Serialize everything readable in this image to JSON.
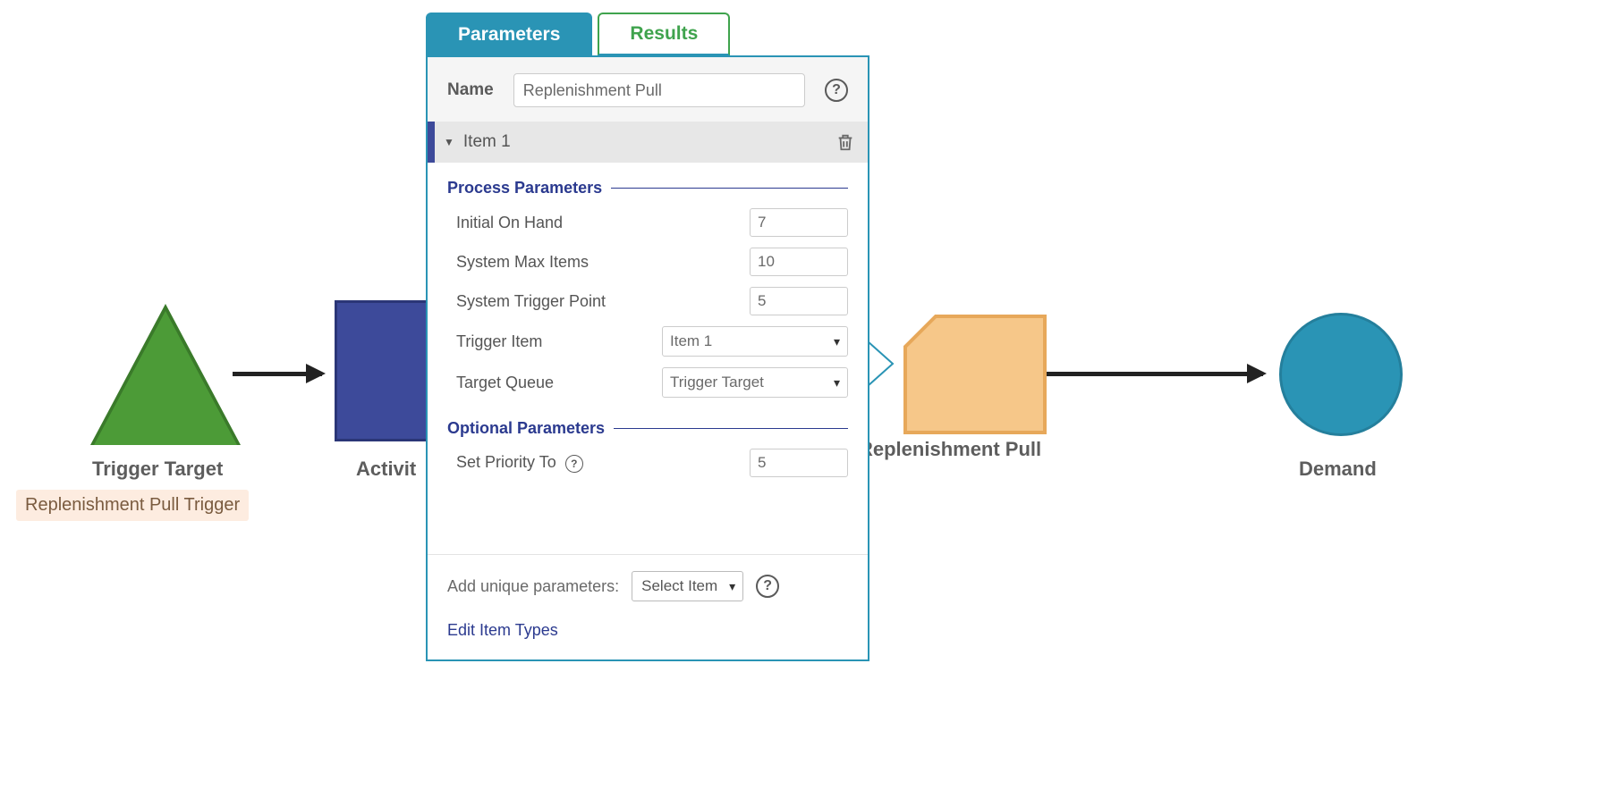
{
  "nodes": {
    "trigger_target": {
      "label": "Trigger Target",
      "badge": "Replenishment Pull Trigger"
    },
    "activity": {
      "label": "Activit"
    },
    "replenishment_pull": {
      "label": "Replenishment Pull"
    },
    "demand": {
      "label": "Demand"
    }
  },
  "panel": {
    "tabs": {
      "parameters": "Parameters",
      "results": "Results",
      "active": "parameters"
    },
    "name": {
      "label": "Name",
      "value": "Replenishment Pull"
    },
    "item": {
      "label": "Item 1"
    },
    "sections": {
      "process": {
        "title": "Process Parameters",
        "initial_on_hand": {
          "label": "Initial On Hand",
          "value": "7"
        },
        "system_max_items": {
          "label": "System Max Items",
          "value": "10"
        },
        "system_trigger_point": {
          "label": "System Trigger Point",
          "value": "5"
        },
        "trigger_item": {
          "label": "Trigger Item",
          "value": "Item 1"
        },
        "target_queue": {
          "label": "Target Queue",
          "value": "Trigger Target"
        }
      },
      "optional": {
        "title": "Optional Parameters",
        "set_priority": {
          "label": "Set Priority To",
          "value": "5"
        }
      }
    },
    "footer": {
      "add_label": "Add unique parameters:",
      "select_placeholder": "Select Item",
      "edit_link": "Edit Item Types"
    }
  }
}
